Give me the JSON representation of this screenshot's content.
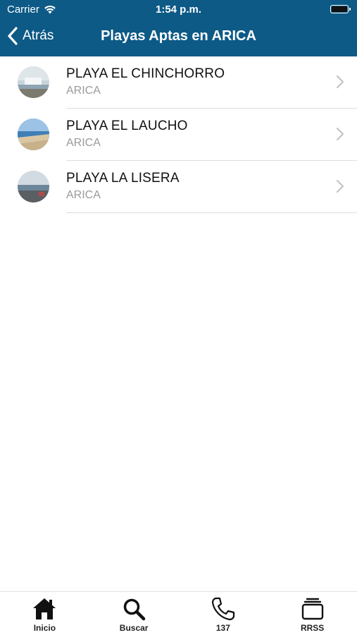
{
  "status_bar": {
    "carrier": "Carrier",
    "time": "1:54 p.m."
  },
  "nav": {
    "back_label": "Atrás",
    "title": "Playas Aptas en ARICA"
  },
  "beaches": [
    {
      "name": "PLAYA EL CHINCHORRO",
      "city": "ARICA"
    },
    {
      "name": "PLAYA EL LAUCHO",
      "city": "ARICA"
    },
    {
      "name": "PLAYA LA LISERA",
      "city": "ARICA"
    }
  ],
  "tab_bar": {
    "items": [
      {
        "label": "Inicio",
        "icon": "home-icon"
      },
      {
        "label": "Buscar",
        "icon": "search-icon"
      },
      {
        "label": "137",
        "icon": "phone-icon"
      },
      {
        "label": "RRSS",
        "icon": "stack-icon"
      }
    ]
  },
  "colors": {
    "header": "#0d5a86",
    "separator": "#dddddd",
    "subtitle": "#9a9a9a"
  }
}
